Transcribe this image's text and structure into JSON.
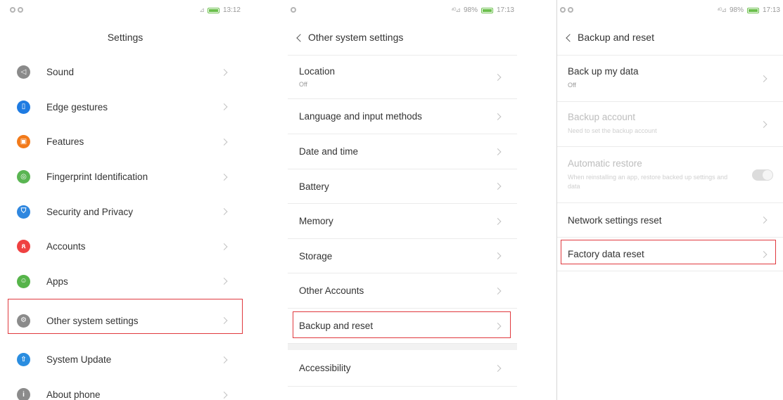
{
  "screen1": {
    "status": {
      "time": "13:12",
      "signal": "⊿"
    },
    "title": "Settings",
    "items": [
      {
        "label": "Sound",
        "icon": "speaker-icon",
        "color": "#8a8a8a",
        "glyph": "◁"
      },
      {
        "label": "Edge gestures",
        "icon": "edge-gesture-icon",
        "color": "#1e7be2",
        "glyph": "▯"
      },
      {
        "label": "Features",
        "icon": "features-icon",
        "color": "#f27a1a",
        "glyph": "▣"
      },
      {
        "label": "Fingerprint Identification",
        "icon": "fingerprint-icon",
        "color": "#5ab552",
        "glyph": "◎"
      },
      {
        "label": "Security and Privacy",
        "icon": "shield-icon",
        "color": "#2f87df",
        "glyph": "⛉"
      },
      {
        "label": "Accounts",
        "icon": "user-icon",
        "color": "#ef4141",
        "glyph": "ጸ"
      },
      {
        "label": "Apps",
        "icon": "android-icon",
        "color": "#56b44a",
        "glyph": "☺"
      },
      {
        "label": "Other system settings",
        "icon": "gear-icon",
        "color": "#8b8b8b",
        "glyph": "⚙"
      },
      {
        "label": "System Update",
        "icon": "update-arrow-icon",
        "color": "#2a8de0",
        "glyph": "⇧"
      },
      {
        "label": "About phone",
        "icon": "info-icon",
        "color": "#8b8b8b",
        "glyph": "i"
      }
    ]
  },
  "screen2": {
    "status": {
      "battery": "98%",
      "time": "17:13",
      "signal": "⁴ᴳ⊿"
    },
    "title": "Other system settings",
    "items": [
      {
        "label": "Location",
        "sub": "Off"
      },
      {
        "label": "Language and input methods"
      },
      {
        "label": "Date and time"
      },
      {
        "label": "Battery"
      },
      {
        "label": "Memory"
      },
      {
        "label": "Storage"
      },
      {
        "label": "Other Accounts"
      },
      {
        "label": "Backup and reset"
      },
      {
        "label": "Accessibility"
      }
    ]
  },
  "screen3": {
    "status": {
      "battery": "98%",
      "time": "17:13",
      "signal": "⁴ᴳ⊿"
    },
    "title": "Backup and reset",
    "items": [
      {
        "label": "Back up my data",
        "sub": "Off"
      },
      {
        "label": "Backup account",
        "sub": "Need to set the backup account"
      },
      {
        "label": "Automatic restore",
        "sub": "When reinstalling an app, restore backed up settings and data"
      },
      {
        "label": "Network settings reset"
      },
      {
        "label": "Factory data reset"
      }
    ]
  },
  "colors": {
    "highlight": "#e0393e",
    "battery": "#6abf4b"
  }
}
